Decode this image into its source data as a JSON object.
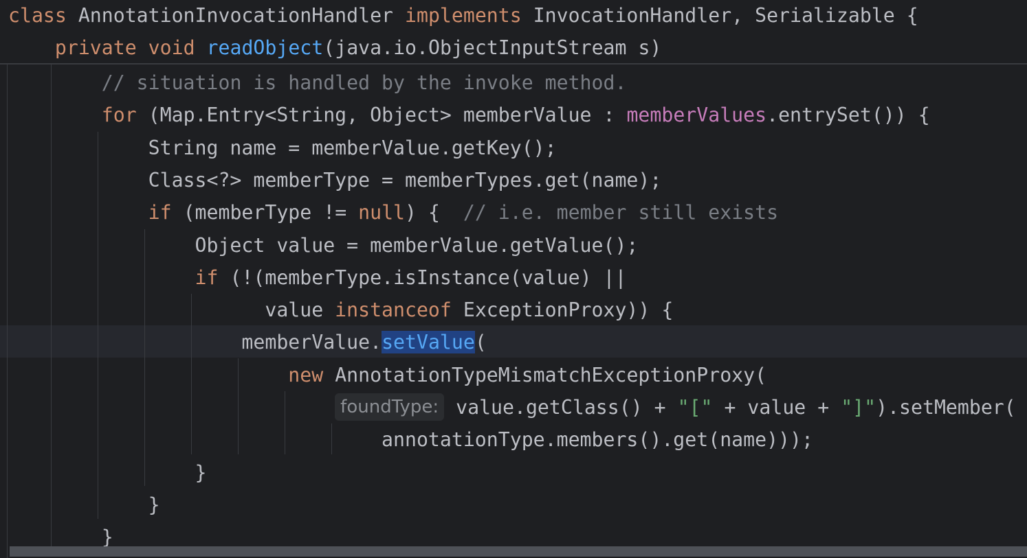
{
  "editor": {
    "sticky_lines": [
      {
        "tokens": [
          {
            "t": "class",
            "c": "kw"
          },
          {
            "t": " AnnotationInvocationHandler "
          },
          {
            "t": "implements",
            "c": "kw"
          },
          {
            "t": " InvocationHandler, Serializable {"
          }
        ]
      },
      {
        "tokens": [
          {
            "t": "    "
          },
          {
            "t": "private",
            "c": "kw"
          },
          {
            "t": " "
          },
          {
            "t": "void",
            "c": "kw"
          },
          {
            "t": " "
          },
          {
            "t": "readObject",
            "c": "fn"
          },
          {
            "t": "(java.io.ObjectInputStream s)"
          }
        ]
      }
    ],
    "code_lines": [
      {
        "tokens": [
          {
            "t": "        "
          },
          {
            "t": "// situation is handled by the invoke method.",
            "c": "cm"
          }
        ]
      },
      {
        "tokens": [
          {
            "t": "        "
          },
          {
            "t": "for",
            "c": "kw"
          },
          {
            "t": " (Map.Entry<String, Object> memberValue : "
          },
          {
            "t": "memberValues",
            "c": "fld"
          },
          {
            "t": ".entrySet()) {"
          }
        ]
      },
      {
        "tokens": [
          {
            "t": "            String name = memberValue.getKey();"
          }
        ]
      },
      {
        "tokens": [
          {
            "t": "            Class<?> memberType = memberTypes.get(name);"
          }
        ]
      },
      {
        "tokens": [
          {
            "t": "            "
          },
          {
            "t": "if",
            "c": "kw"
          },
          {
            "t": " (memberType != "
          },
          {
            "t": "null",
            "c": "kw"
          },
          {
            "t": ") {  "
          },
          {
            "t": "// i.e. member still exists",
            "c": "cm"
          }
        ]
      },
      {
        "tokens": [
          {
            "t": "                Object value = memberValue.getValue();"
          }
        ]
      },
      {
        "tokens": [
          {
            "t": "                "
          },
          {
            "t": "if",
            "c": "kw"
          },
          {
            "t": " (!(memberType.isInstance(value) ||"
          }
        ]
      },
      {
        "tokens": [
          {
            "t": "                      value "
          },
          {
            "t": "instanceof",
            "c": "kw"
          },
          {
            "t": " ExceptionProxy)) {"
          }
        ]
      },
      {
        "tokens": [
          {
            "t": "                    memberValue."
          },
          {
            "t": "setValue",
            "c": "fn sel"
          },
          {
            "t": "("
          }
        ]
      },
      {
        "tokens": [
          {
            "t": "                        "
          },
          {
            "t": "new",
            "c": "kw"
          },
          {
            "t": " AnnotationTypeMismatchExceptionProxy("
          }
        ]
      },
      {
        "tokens": [
          {
            "t": "                            "
          },
          {
            "t": "foundType:",
            "c": "hint"
          },
          {
            "t": " value.getClass() + "
          },
          {
            "t": "\"[\"",
            "c": "str"
          },
          {
            "t": " + value + "
          },
          {
            "t": "\"]\"",
            "c": "str"
          },
          {
            "t": ").setMember("
          }
        ]
      },
      {
        "tokens": [
          {
            "t": "                                annotationType.members().get(name)));"
          }
        ]
      },
      {
        "tokens": [
          {
            "t": "                }"
          }
        ]
      },
      {
        "tokens": [
          {
            "t": "            }"
          }
        ]
      },
      {
        "tokens": [
          {
            "t": "        }"
          }
        ]
      }
    ]
  }
}
